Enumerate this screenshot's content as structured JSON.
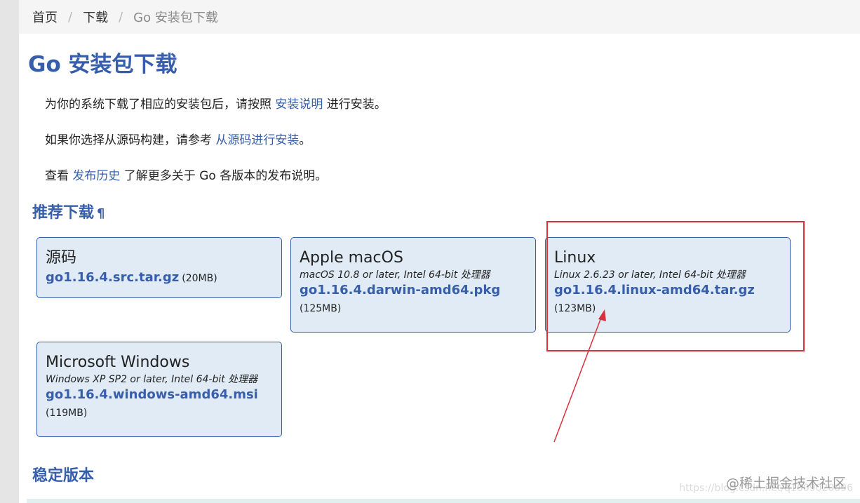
{
  "breadcrumb": {
    "home": "首页",
    "sep": "/",
    "downloads": "下载",
    "current": "Go 安装包下载"
  },
  "title": "Go 安装包下载",
  "intro": {
    "p1_before": "为你的系统下载了相应的安装包后，请按照 ",
    "p1_link": "安装说明",
    "p1_after": " 进行安装。",
    "p2_before": "如果你选择从源码构建，请参考 ",
    "p2_link": "从源码进行安装",
    "p2_after": "。",
    "p3_before": "查看 ",
    "p3_link": "发布历史",
    "p3_after": " 了解更多关于 Go 各版本的发布说明。"
  },
  "featured": {
    "heading": "推荐下载",
    "pilcrow": "¶",
    "cards": [
      {
        "name": "源码",
        "file": "go1.16.4.src.tar.gz",
        "size": "(20MB)"
      },
      {
        "name": "Apple macOS",
        "req": "macOS 10.8 or later, Intel 64-bit 处理器",
        "file": "go1.16.4.darwin-amd64.pkg",
        "size": "(125MB)"
      },
      {
        "name": "Linux",
        "req": "Linux 2.6.23 or later, Intel 64-bit 处理器",
        "file": "go1.16.4.linux-amd64.tar.gz",
        "size": "(123MB)"
      },
      {
        "name": "Microsoft Windows",
        "req": "Windows XP SP2 or later, Intel 64-bit 处理器",
        "file": "go1.16.4.windows-amd64.msi",
        "size": "(119MB)"
      }
    ]
  },
  "stable_heading": "稳定版本",
  "watermark": "@稀土掘金技术社区",
  "watermark_url": "https://blog.csdn.net/q1009020096",
  "colors": {
    "link": "#375eab",
    "card_bg": "#e0ebf5",
    "highlight": "#d9313b"
  }
}
